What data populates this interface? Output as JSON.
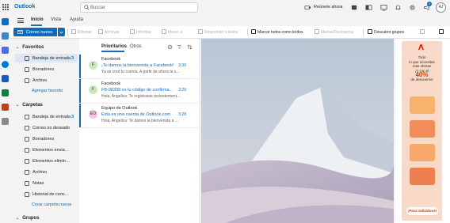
{
  "app": {
    "name": "Outlook"
  },
  "search": {
    "placeholder": "Buscar"
  },
  "topbar": {
    "meet_now": "Reúnete ahora",
    "notifications_count": "1",
    "avatar_initials": "AJ"
  },
  "menu": {
    "tabs": [
      "Inicio",
      "Vista",
      "Ayuda"
    ]
  },
  "ribbon": {
    "new_mail": "Correo nuevo",
    "delete": "Eliminar",
    "archive": "Archivar",
    "report": "Informar",
    "move_to": "Mover a",
    "reply_all": "Responder a todos",
    "mark_all_read": "Marcar todos como leídos",
    "flag": "Marcar/Desmarcar",
    "discover_groups": "Descubrir grupos"
  },
  "folders": {
    "favorites_header": "Favoritos",
    "favorites": [
      {
        "label": "Bandeja de entrada",
        "count": "3"
      },
      {
        "label": "Borradores",
        "count": ""
      },
      {
        "label": "Archivo",
        "count": ""
      }
    ],
    "add_favorite": "Agregar favorito",
    "folders_header": "Carpetas",
    "items": [
      {
        "label": "Bandeja de entrada",
        "count": "3"
      },
      {
        "label": "Correo no deseado",
        "count": ""
      },
      {
        "label": "Borradores",
        "count": ""
      },
      {
        "label": "Elementos enviados",
        "count": ""
      },
      {
        "label": "Elementos eliminados",
        "count": ""
      },
      {
        "label": "Archivo",
        "count": ""
      },
      {
        "label": "Notas",
        "count": ""
      },
      {
        "label": "Historial de conversaciones",
        "count": ""
      }
    ],
    "new_folder": "Crear carpeta nueva",
    "groups_header": "Grupos"
  },
  "list": {
    "tabs": [
      "Prioritarios",
      "Otros"
    ],
    "messages": [
      {
        "initial": "F",
        "sender": "Facebook",
        "subject": "¡Te damos la bienvenida a Facebook!",
        "time": "3:30",
        "preview": "Ya se creó tu cuenta. A partir de ahora te s..."
      },
      {
        "initial": "F",
        "sender": "Facebook",
        "subject": "FB-98308 es tu código de confirma...",
        "time": "3:29",
        "preview": "Hola, Angelica: Te registraste recientement..."
      },
      {
        "initial": "EO",
        "sender": "Equipo de Outlook",
        "subject": "Esta es una cuenta de Outlook.com",
        "time": "3:28",
        "preview": "Hola, Angelica: Te damos la bienvenida a ..."
      }
    ]
  },
  "ad": {
    "line1": "Todo",
    "line2": "lo que necesitas",
    "line3": "más ofertas",
    "line4": "¡Y con el",
    "percent": "40%",
    "line5": "de descuento!",
    "cta": "¡Para individuos!"
  },
  "colors": {
    "accent": "#0f6cbd",
    "ad_bg": "#f9d9c7"
  }
}
